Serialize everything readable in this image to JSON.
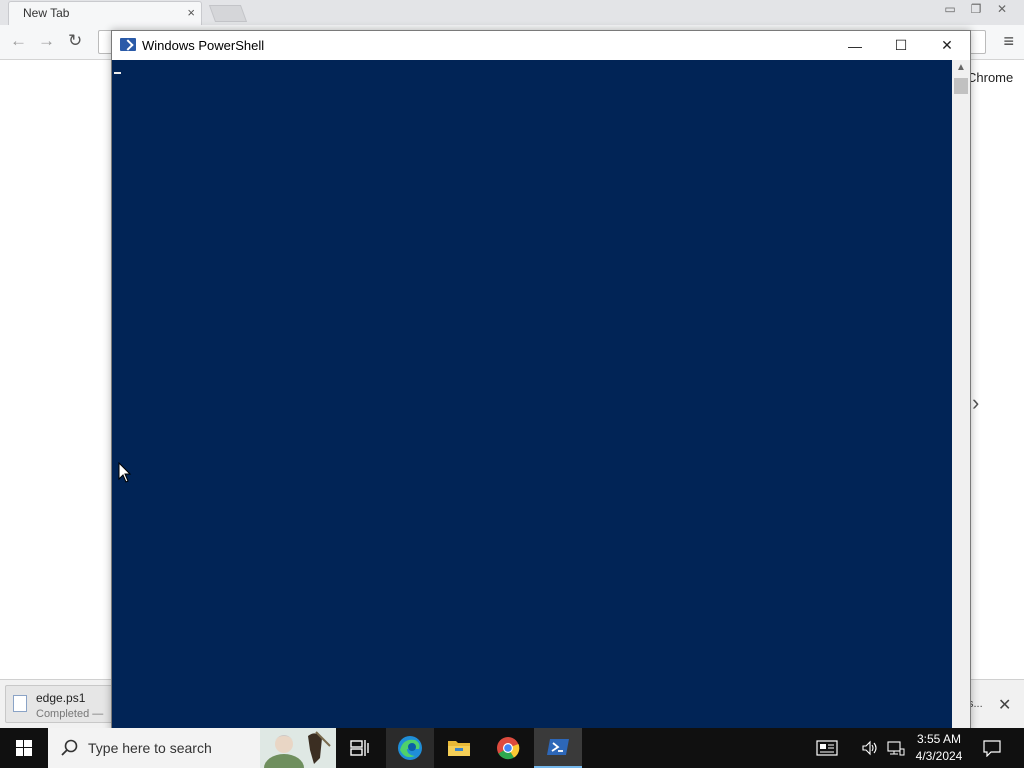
{
  "chrome": {
    "tab_title": "New Tab",
    "tab_close": "×",
    "window_buttons": [
      "▭",
      "❐",
      "✕"
    ],
    "back": "←",
    "forward": "→",
    "reload": "↻",
    "menu": "≡",
    "partial_text": "Chrome",
    "chevron": "›"
  },
  "download_bar": {
    "file_name": "edge.ps1",
    "status": "Completed —",
    "show_all": "s...",
    "close": "✕"
  },
  "powershell": {
    "title": "Windows PowerShell",
    "minimize": "—",
    "maximize": "☐",
    "close": "✕",
    "console_bg": "#012456",
    "scroll_up": "▲"
  },
  "taskbar": {
    "search_placeholder": "Type here to search",
    "time": "3:55 AM",
    "date": "4/3/2024",
    "icons": [
      "windows-start-icon",
      "search-icon",
      "task-view-icon",
      "edge-icon",
      "file-explorer-icon",
      "chrome-icon",
      "powershell-icon",
      "news-icon",
      "volume-icon",
      "network-icon",
      "notification-icon"
    ]
  }
}
